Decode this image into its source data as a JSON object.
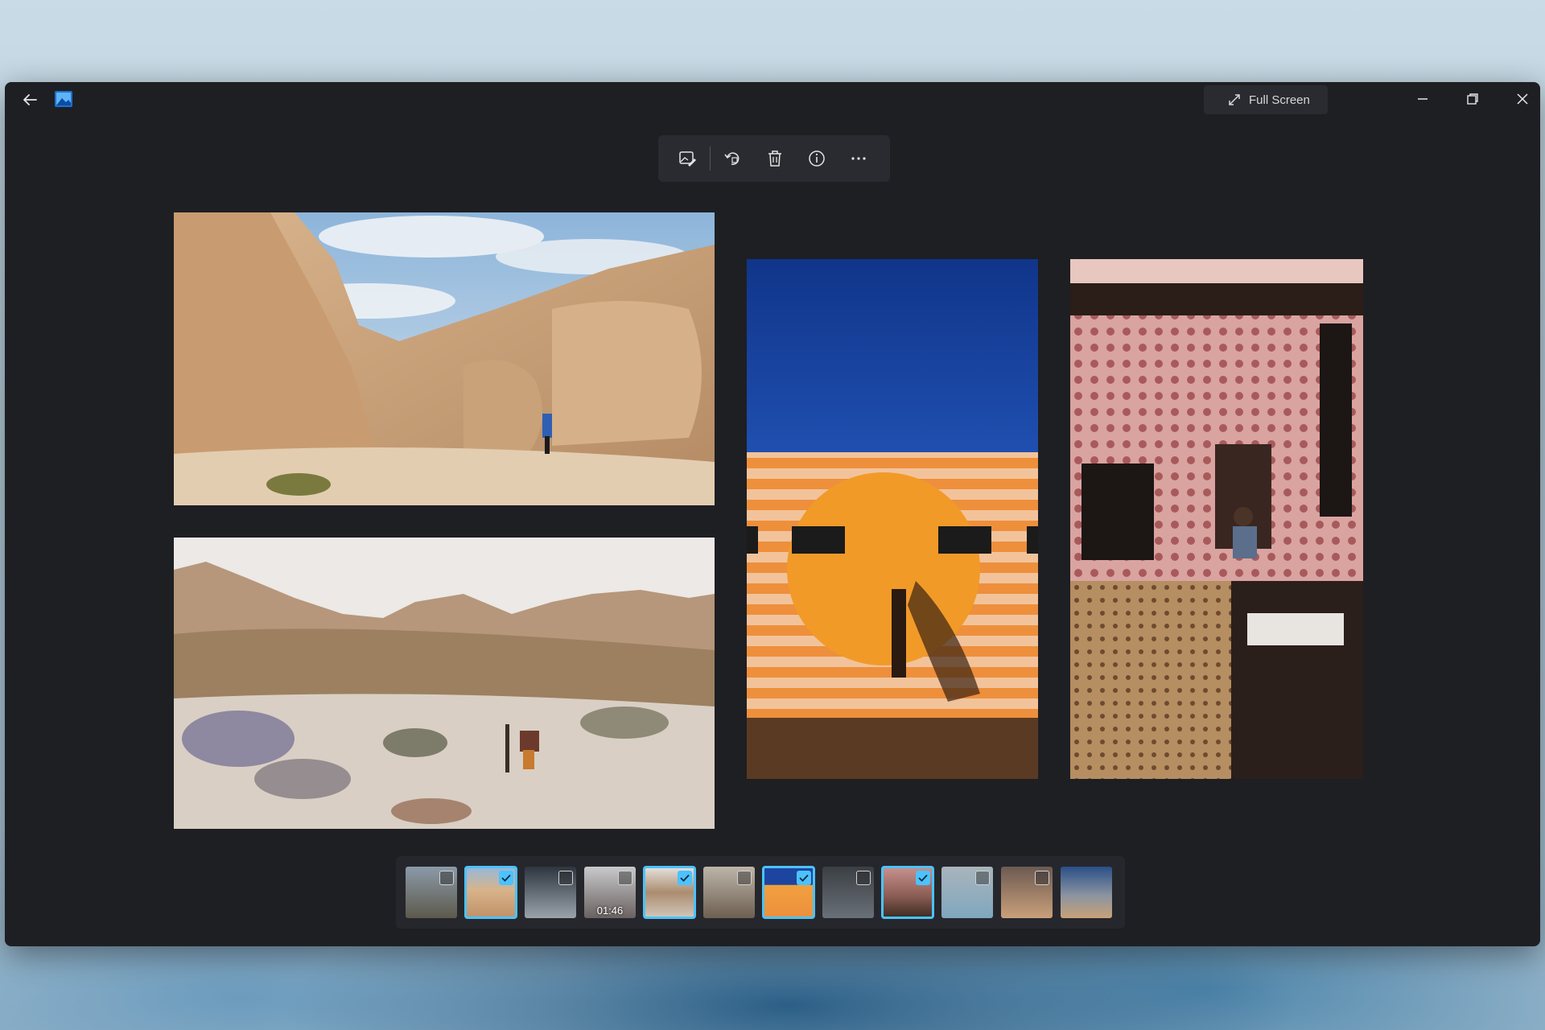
{
  "window": {
    "full_screen_label": "Full Screen"
  },
  "toolbar": {
    "items": [
      {
        "name": "edit-image-icon"
      },
      {
        "name": "rotate-icon"
      },
      {
        "name": "delete-icon"
      },
      {
        "name": "info-icon"
      },
      {
        "name": "more-icon"
      }
    ]
  },
  "filmstrip": {
    "thumbs": [
      {
        "selected": false
      },
      {
        "selected": true
      },
      {
        "selected": false
      },
      {
        "selected": false,
        "duration": "01:46"
      },
      {
        "selected": true
      },
      {
        "selected": false
      },
      {
        "selected": true
      },
      {
        "selected": false
      },
      {
        "selected": true
      },
      {
        "selected": false
      },
      {
        "selected": false
      },
      {
        "selected": false
      }
    ]
  },
  "colors": {
    "window_bg": "#1e1f23",
    "accent": "#4cc2ff",
    "toolbar_bg": "#2a2b30"
  }
}
